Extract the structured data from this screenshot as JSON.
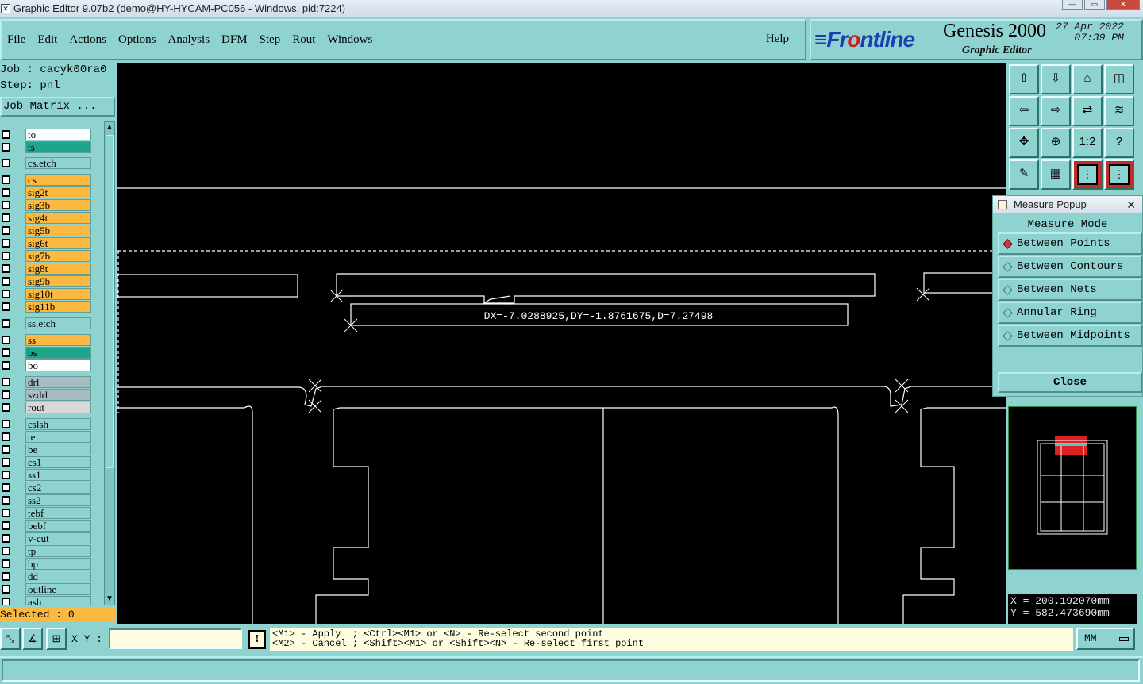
{
  "window": {
    "title": "Graphic Editor 9.07b2 (demo@HY-HYCAM-PC056 - Windows, pid:7224)"
  },
  "menu": {
    "items": [
      "File",
      "Edit",
      "Actions",
      "Options",
      "Analysis",
      "DFM",
      "Step",
      "Rout",
      "Windows"
    ],
    "help": "Help"
  },
  "brand": {
    "logo_a": "≡Fr",
    "logo_b": "o",
    "logo_c": "ntline",
    "product": "Genesis 2000",
    "subtitle": "Graphic Editor",
    "date": "27 Apr 2022",
    "time": "07:39 PM"
  },
  "job": {
    "job": "Job : cacyk00ra0",
    "step": "Step: pnl",
    "matrix_button": "Job Matrix ..."
  },
  "layers": [
    {
      "name": "to",
      "color": "#ffffff"
    },
    {
      "name": "ts",
      "color": "#1fa58a"
    },
    {
      "name": "cs.etch",
      "color": "#8fd3d0"
    },
    {
      "name": "cs",
      "color": "#fbb941"
    },
    {
      "name": "sig2t",
      "color": "#fbb941"
    },
    {
      "name": "sig3b",
      "color": "#fbb941"
    },
    {
      "name": "sig4t",
      "color": "#fbb941"
    },
    {
      "name": "sig5b",
      "color": "#fbb941"
    },
    {
      "name": "sig6t",
      "color": "#fbb941"
    },
    {
      "name": "sig7b",
      "color": "#fbb941"
    },
    {
      "name": "sig8t",
      "color": "#fbb941"
    },
    {
      "name": "sig9b",
      "color": "#fbb941"
    },
    {
      "name": "sig10t",
      "color": "#fbb941"
    },
    {
      "name": "sig11b",
      "color": "#fbb941"
    },
    {
      "name": "ss.etch",
      "color": "#8fd3d0"
    },
    {
      "name": "ss",
      "color": "#fbb941"
    },
    {
      "name": "bs",
      "color": "#1fa58a"
    },
    {
      "name": "bo",
      "color": "#ffffff"
    },
    {
      "name": "drl",
      "color": "#a8bcc4"
    },
    {
      "name": "szdrl",
      "color": "#a8bcc4"
    },
    {
      "name": "rout",
      "color": "#d8d8d8"
    },
    {
      "name": "cslsh",
      "color": "#8fd3d0"
    },
    {
      "name": "te",
      "color": "#8fd3d0"
    },
    {
      "name": "be",
      "color": "#8fd3d0"
    },
    {
      "name": "cs1",
      "color": "#8fd3d0"
    },
    {
      "name": "ss1",
      "color": "#8fd3d0"
    },
    {
      "name": "cs2",
      "color": "#8fd3d0"
    },
    {
      "name": "ss2",
      "color": "#8fd3d0"
    },
    {
      "name": "tebf",
      "color": "#8fd3d0"
    },
    {
      "name": "bebf",
      "color": "#8fd3d0"
    },
    {
      "name": "v-cut",
      "color": "#8fd3d0"
    },
    {
      "name": "tp",
      "color": "#8fd3d0"
    },
    {
      "name": "bp",
      "color": "#8fd3d0"
    },
    {
      "name": "dd",
      "color": "#8fd3d0"
    },
    {
      "name": "outline",
      "color": "#8fd3d0"
    },
    {
      "name": "ash",
      "color": "#8fd3d0"
    }
  ],
  "selected": "Selected : 0",
  "measure_text": "DX=-7.0288925,DY=-1.8761675,D=7.27498",
  "popup": {
    "title": "Measure Popup",
    "mode_label": "Measure Mode",
    "options": [
      "Between Points",
      "Between Contours",
      "Between Nets",
      "Annular Ring",
      "Between Midpoints"
    ],
    "selected_option": 0,
    "close": "Close"
  },
  "toolbar_icons": [
    "zoom-home-icon",
    "zoom-step-icon",
    "pan-icon",
    "zoom-window-icon",
    "pan-left-icon",
    "pan-right-icon",
    "flip-icon",
    "snap-icon",
    "fit-icon",
    "center-icon",
    "ratio-icon",
    "help-icon",
    "tools-icon",
    "grid-icon",
    "layers-a-icon",
    "layers-b-icon"
  ],
  "toolbar_labels": {
    "ratio": "1:2",
    "help": "?"
  },
  "coords": {
    "x": "X = 200.192070mm",
    "y": "Y = 582.473690mm"
  },
  "bottom": {
    "xy_label": "X Y :",
    "xy_value": "",
    "bang": "!",
    "msg_line1": "<M1> - Apply  ; <Ctrl><M1> or <N> - Re-select second point",
    "msg_line2": "<M2> - Cancel ; <Shift><M1> or <Shift><N> - Re-select first point",
    "units": "MM"
  }
}
